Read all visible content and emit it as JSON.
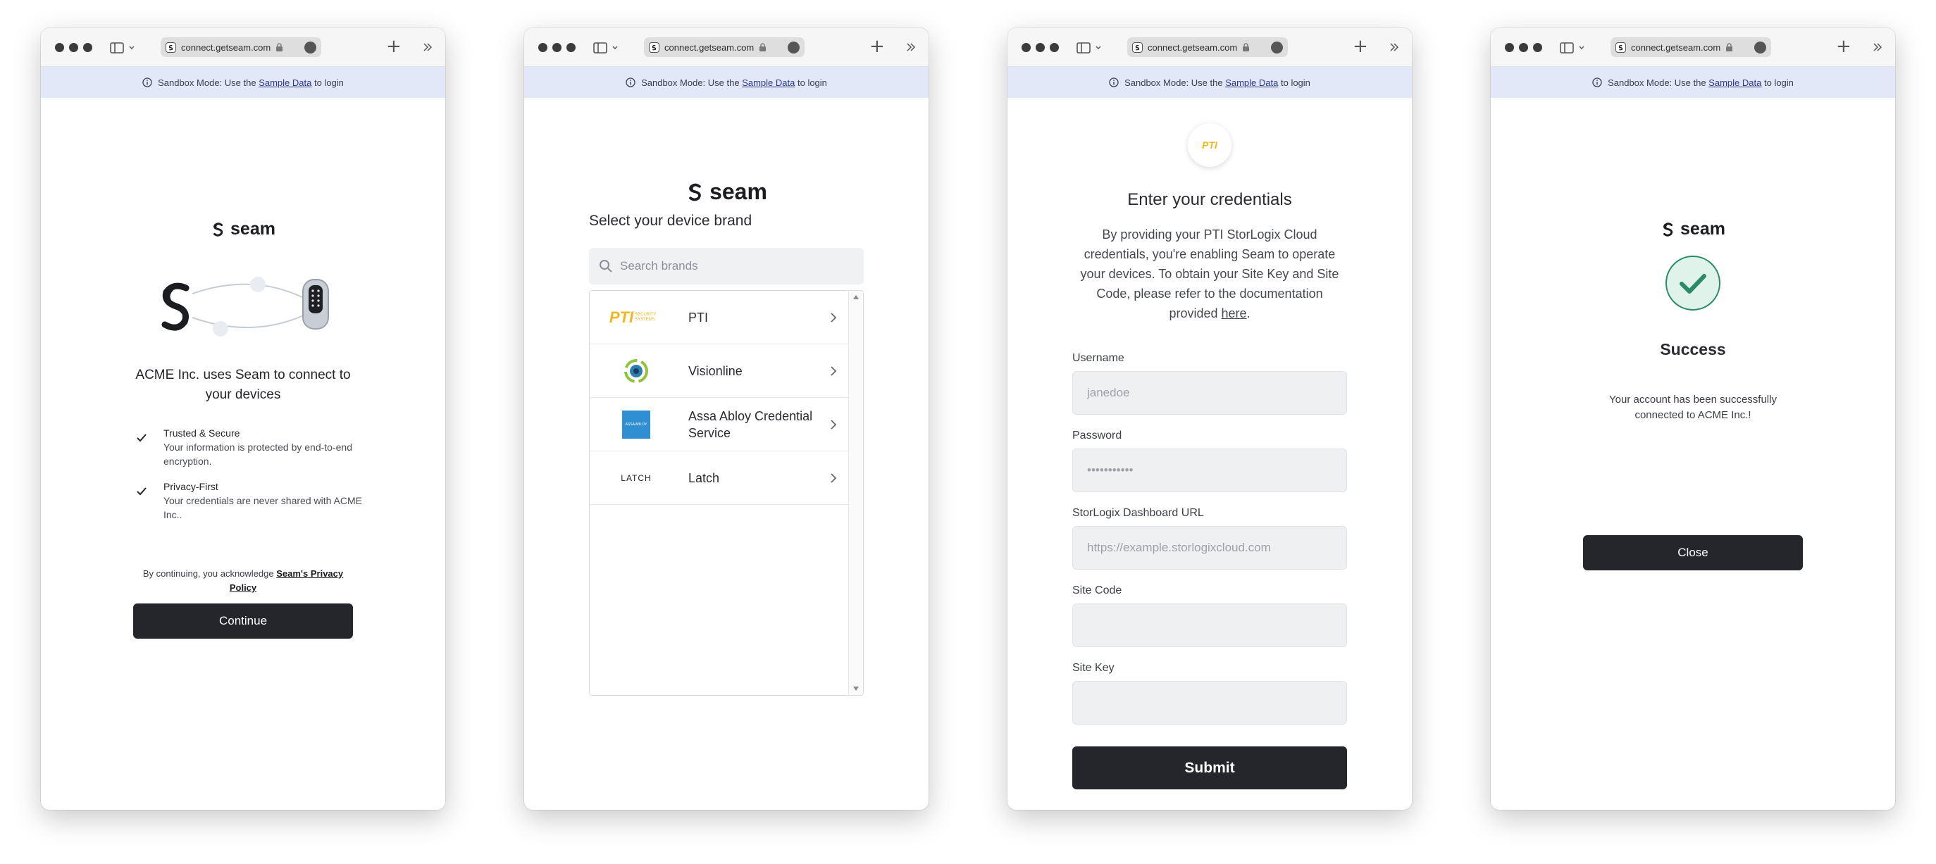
{
  "browser": {
    "url": "connect.getseam.com",
    "new_tab_glyph": "+",
    "icons": [
      "sidebar-icon",
      "chevron-down-icon",
      "lock-icon",
      "share-icon",
      "new-tab-icon",
      "chevron-double-right-icon"
    ]
  },
  "banner": {
    "prefix": "Sandbox Mode: Use the",
    "link": "Sample Data",
    "suffix": "to login"
  },
  "brand": {
    "logo_text": "seam",
    "primary_color": "#25262b",
    "success_color": "#2b8a67"
  },
  "screen1": {
    "heading": "ACME Inc. uses Seam to connect to your devices",
    "features": [
      {
        "title": "Trusted & Secure",
        "desc": "Your information is protected by end-to-end encryption."
      },
      {
        "title": "Privacy-First",
        "desc": "Your credentials are never shared with ACME Inc.."
      }
    ],
    "disclaimer_prefix": "By continuing, you acknowledge",
    "disclaimer_link": "Seam's Privacy Policy",
    "continue_label": "Continue"
  },
  "screen2": {
    "heading": "Select your device brand",
    "search_placeholder": "Search brands",
    "brands": [
      {
        "name": "PTI",
        "logo": "PTI",
        "logo_sub": "SECURITY SYSTEMS"
      },
      {
        "name": "Visionline",
        "logo": ""
      },
      {
        "name": "Assa Abloy Credential Service",
        "logo": "ASSA ABLOY"
      },
      {
        "name": "Latch",
        "logo": "LATCH"
      }
    ]
  },
  "screen3": {
    "brand_badge": "PTI",
    "heading": "Enter your credentials",
    "description": "By providing your PTI StorLogix Cloud credentials, you're enabling Seam to operate your devices. To obtain your Site Key and Site Code, please refer to the documentation provided",
    "here_link": "here",
    "period": ".",
    "fields": [
      {
        "label": "Username",
        "placeholder": "janedoe"
      },
      {
        "label": "Password",
        "placeholder": "•••••••••••"
      },
      {
        "label": "StorLogix Dashboard URL",
        "placeholder": "https://example.storlogixcloud.com"
      },
      {
        "label": "Site Code",
        "placeholder": ""
      },
      {
        "label": "Site Key",
        "placeholder": ""
      }
    ],
    "submit_label": "Submit"
  },
  "screen4": {
    "heading": "Success",
    "message": "Your account has been successfully connected to ACME Inc.!",
    "close_label": "Close"
  }
}
